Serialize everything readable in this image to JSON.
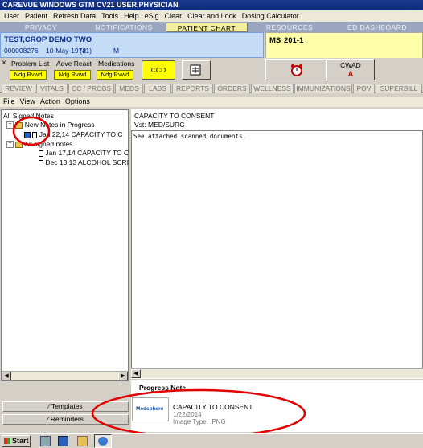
{
  "window": {
    "title": "CAREVUE WINDOWS GTM CV21 USER,PHYSICIAN"
  },
  "menu": [
    "User",
    "Patient",
    "Refresh Data",
    "Tools",
    "Help",
    "eSig",
    "Clear",
    "Clear and Lock",
    "Dosing Calculator"
  ],
  "top_tabs": [
    "PRIVACY",
    "NOTIFICATIONS",
    "PATIENT CHART",
    "RESOURCES",
    "ED DASHBOARD"
  ],
  "patient": {
    "name": "TEST,CROP DEMO TWO",
    "mrn": "000008276",
    "dob": "10-May-1972",
    "age": "(41)",
    "sex": "M"
  },
  "location": {
    "unit": "MS",
    "room": "201-1"
  },
  "alerts": {
    "close": "×",
    "problem_list": {
      "label": "Problem List",
      "value": "Ndg Rvwd"
    },
    "adv_react": {
      "label": "Adve React",
      "value": "Ndg Rvwd"
    },
    "medications": {
      "label": "Medications",
      "value": "Ndg Rvwd"
    },
    "ccd": "CCD",
    "cwad": {
      "label": "CWAD",
      "value": "A"
    }
  },
  "sub_tabs": [
    "REVIEW",
    "VITALS",
    "CC / PROBS",
    "MEDS",
    "LABS",
    "REPORTS",
    "ORDERS",
    "WELLNESS",
    "IMMUNIZATIONS",
    "POV",
    "SUPERBILL"
  ],
  "notes_menu": [
    "File",
    "View",
    "Action",
    "Options"
  ],
  "tree": {
    "header": "All Signed Notes",
    "group1": "New Notes in Progress",
    "item1": "Jan 22,14  CAPACITY TO C",
    "group2": "All signed notes",
    "item2": "Jan 17,14  CAPACITY TO C",
    "item3": "Dec 13,13  ALCOHOL SCRI"
  },
  "note": {
    "title": "CAPACITY TO CONSENT",
    "visit": "Vst:  MED/SURG",
    "body": "See attached scanned documents."
  },
  "progress_note": {
    "header": "Progress Note",
    "title": "CAPACITY TO CONSENT",
    "date": "1/22/2014",
    "type": "Image Type: .PNG",
    "logo": "Medsphere"
  },
  "bottom_buttons": {
    "templates": "Templates",
    "reminders": "Reminders"
  },
  "taskbar": {
    "start": "Start"
  },
  "colors": {
    "annotation": "#e00000",
    "title_bar": "#0b2a7a",
    "active_tab": "#f3ef9c",
    "patient_bg": "#c5dcf7",
    "location_bg": "#ffffa8"
  }
}
